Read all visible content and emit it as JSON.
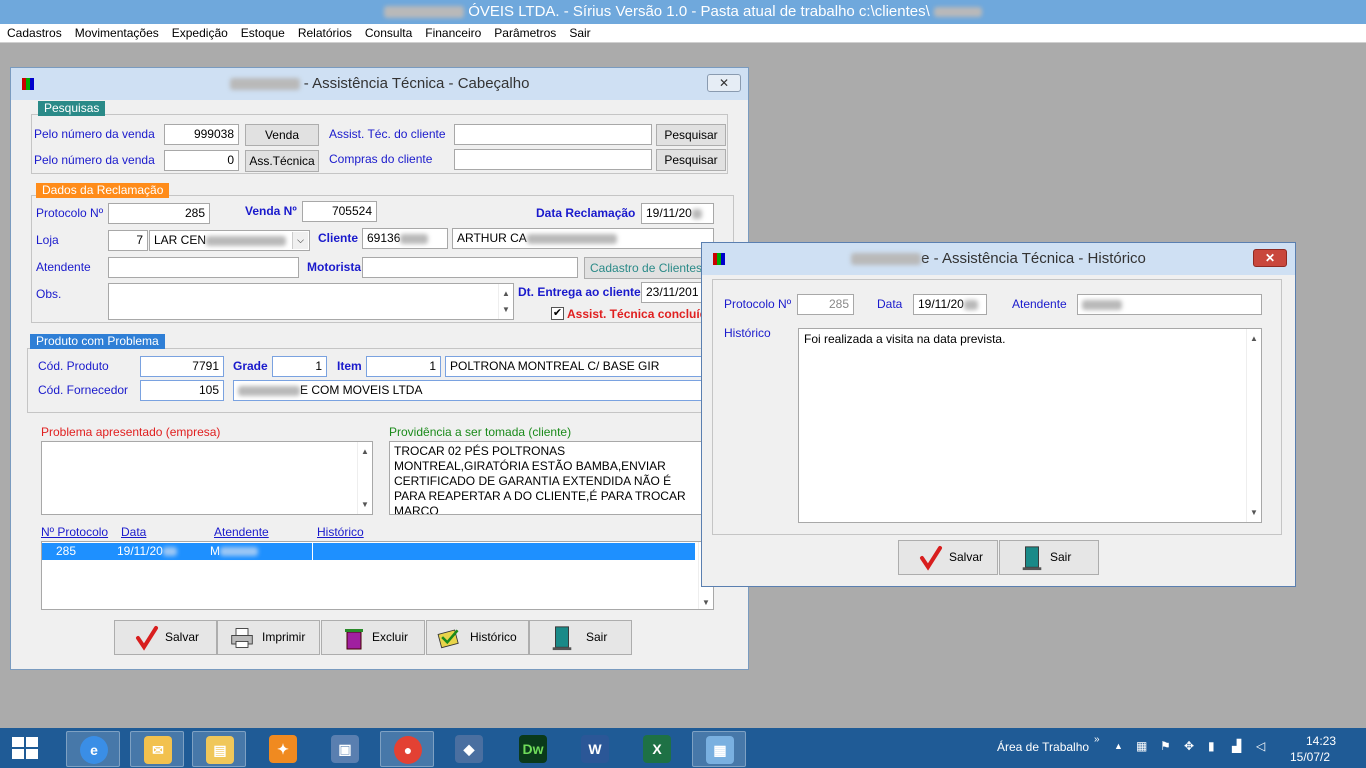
{
  "app_title": "ÓVEIS LTDA. - Sírius Versão 1.0 - Pasta atual de trabalho c:\\clientes\\",
  "menu": [
    "Cadastros",
    "Movimentações",
    "Expedição",
    "Estoque",
    "Relatórios",
    "Consulta",
    "Financeiro",
    "Parâmetros",
    "Sair"
  ],
  "main_window": {
    "title": " - Assistência Técnica - Cabeçalho",
    "pesquisas": {
      "tag": "Pesquisas",
      "pelo_venda_label": "Pelo número da venda",
      "pelo_venda_value": "999038",
      "venda_btn": "Venda",
      "pelo_venda2_label": "Pelo número da venda",
      "pelo_venda2_value": "0",
      "asstec_btn": "Ass.Técnica",
      "assist_cliente_label": "Assist. Téc. do cliente",
      "assist_cliente_value": "",
      "compras_cliente_label": "Compras do cliente",
      "compras_cliente_value": "",
      "pesquisar1": "Pesquisar",
      "pesquisar2": "Pesquisar"
    },
    "dados": {
      "tag": "Dados da Reclamação",
      "protocolo_label": "Protocolo Nº",
      "protocolo_value": "285",
      "venda_label": "Venda Nº",
      "venda_value": "705524",
      "data_recl_label": "Data Reclamação",
      "data_recl_value": "19/11/20",
      "loja_label": "Loja",
      "loja_num": "7",
      "loja_name": "LAR CEN",
      "cliente_label": "Cliente",
      "cliente_code": "69136",
      "cliente_name": "ARTHUR CA",
      "atendente_label": "Atendente",
      "atendente_value": "",
      "motorista_label": "Motorista",
      "motorista_value": "",
      "cadastro_btn": "Cadastro de Clientes",
      "obs_label": "Obs.",
      "obs_value": "",
      "dt_entrega_label": "Dt. Entrega ao cliente",
      "dt_entrega_value": "23/11/201",
      "concluida_label": "Assist. Técnica concluíd"
    },
    "produto": {
      "tag": "Produto com Problema",
      "cod_prod_label": "Cód. Produto",
      "cod_prod_value": "7791",
      "grade_label": "Grade",
      "grade_value": "1",
      "item_label": "Item",
      "item_value": "1",
      "prod_desc": "POLTRONA MONTREAL C/ BASE GIR",
      "cod_forn_label": "Cód. Fornecedor",
      "cod_forn_value": "105",
      "forn_name": "E COM MOVEIS LTDA"
    },
    "problema_label": "Problema apresentado (empresa)",
    "problema_value": "",
    "providencia_label": "Providência a ser tomada (cliente)",
    "providencia_value": "TROCAR 02 PÉS POLTRONAS MONTREAL,GIRATÓRIA ESTÃO BAMBA,ENVIAR CERTIFICADO DE GARANTIA EXTENDIDA NÃO É PARA REAPERTAR A DO CLIENTE,É PARA TROCAR MARCO",
    "grid": {
      "headers": [
        "Nº Protocolo",
        "Data",
        "Atendente",
        "Histórico"
      ],
      "rows": [
        {
          "protocolo": "285",
          "data": "19/11/20",
          "atendente": "M",
          "historico": ""
        }
      ]
    },
    "buttons": {
      "salvar": "Salvar",
      "imprimir": "Imprimir",
      "excluir": "Excluir",
      "historico": "Histórico",
      "sair": "Sair"
    }
  },
  "hist_window": {
    "title": "e - Assistência Técnica - Histórico",
    "protocolo_label": "Protocolo Nº",
    "protocolo_value": "285",
    "data_label": "Data",
    "data_value": "19/11/20",
    "atendente_label": "Atendente",
    "atendente_value": "",
    "historico_label": "Histórico",
    "historico_value": "Foi realizada a visita na data prevista.",
    "salvar": "Salvar",
    "sair": "Sair"
  },
  "taskbar": {
    "area_trabalho": "Área de Trabalho",
    "time": "14:23",
    "date": "15/07/2"
  },
  "colors": {
    "pesquisas_tag": "#2a8a88",
    "dados_tag": "#ff8c1a",
    "produto_tag": "#2f7fd6",
    "problema_red": "#e02020",
    "providencia_green": "#1a8a1a",
    "grid_header_blue": "#1a1acc",
    "selection": "#1e90ff"
  }
}
